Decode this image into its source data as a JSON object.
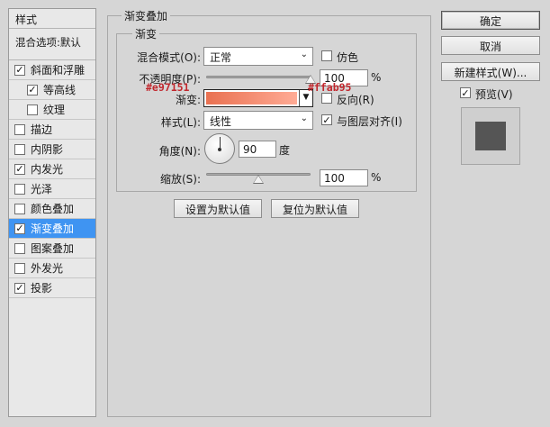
{
  "left_panel": {
    "title": "样式",
    "blend_options": "混合选项:默认",
    "items": [
      {
        "label": "斜面和浮雕",
        "checked": "✓"
      },
      {
        "label": "等高线",
        "checked": "✓"
      },
      {
        "label": "纹理",
        "checked": ""
      },
      {
        "label": "描边",
        "checked": ""
      },
      {
        "label": "内阴影",
        "checked": ""
      },
      {
        "label": "内发光",
        "checked": "✓"
      },
      {
        "label": "光泽",
        "checked": ""
      },
      {
        "label": "颜色叠加",
        "checked": ""
      },
      {
        "label": "渐变叠加",
        "checked": "✓"
      },
      {
        "label": "图案叠加",
        "checked": ""
      },
      {
        "label": "外发光",
        "checked": ""
      },
      {
        "label": "投影",
        "checked": "✓"
      }
    ],
    "selected_item": "渐变叠加"
  },
  "gradient_overlay": {
    "group_title": "渐变叠加",
    "sub_group_title": "渐变",
    "blend_mode_label": "混合模式(O):",
    "blend_mode_value": "正常",
    "dither_label": "仿色",
    "dither_checked": "",
    "opacity_label": "不透明度(P):",
    "opacity_value": "100",
    "opacity_unit": "%",
    "opacity_level": 1.0,
    "gradient_label": "渐变:",
    "gradient_start_color": "#e97151",
    "gradient_end_color": "#ffab95",
    "reverse_label": "反向(R)",
    "reverse_checked": "",
    "style_label": "样式(L):",
    "style_value": "线性",
    "align_label": "与图层对齐(I)",
    "align_checked": "✓",
    "angle_label": "角度(N):",
    "angle_value": "90",
    "angle_unit": "度",
    "scale_label": "缩放(S):",
    "scale_value": "100",
    "scale_unit": "%",
    "scale_level": 0.5,
    "set_default_button": "设置为默认值",
    "reset_default_button": "复位为默认值"
  },
  "annotations": {
    "start_color": "#e97151",
    "end_color": "#ffab95"
  },
  "right_panel": {
    "ok_button": "确定",
    "cancel_button": "取消",
    "new_style_button": "新建样式(W)...",
    "preview_label": "预览(V)",
    "preview_checked": "✓"
  }
}
